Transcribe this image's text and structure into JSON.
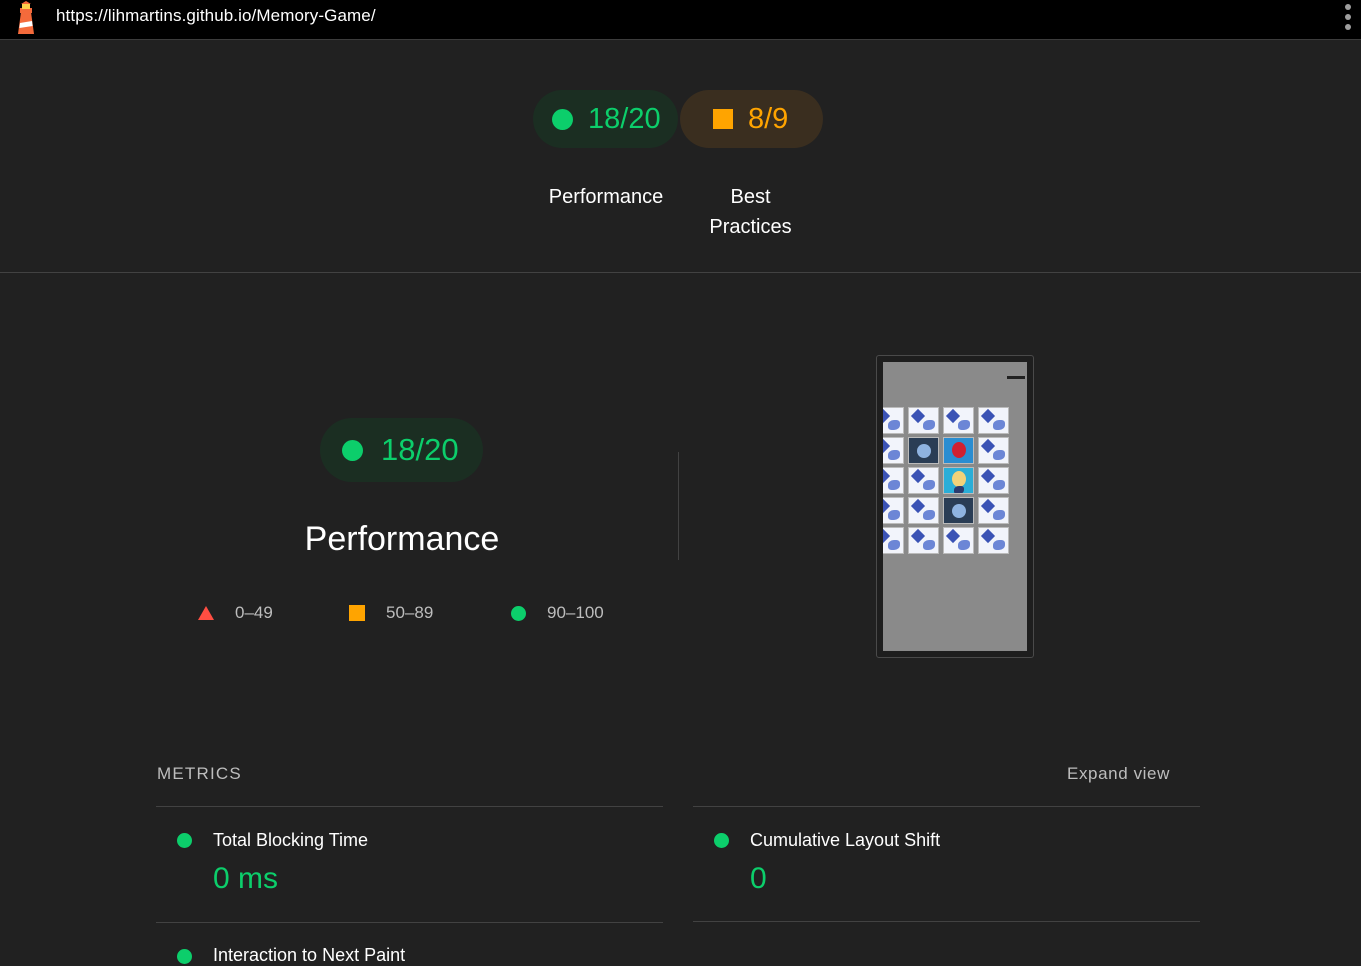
{
  "browser": {
    "url": "https://lihmartins.github.io/Memory-Game/"
  },
  "header_gauges": [
    {
      "score": "18/20",
      "label": "Performance",
      "status": "pass"
    },
    {
      "score": "8/9",
      "label": "Best Practices",
      "status": "average"
    }
  ],
  "main_gauge": {
    "score": "18/20",
    "title": "Performance"
  },
  "legend": [
    {
      "shape": "triangle",
      "range": "0–49",
      "color": "#ff4e42"
    },
    {
      "shape": "square",
      "range": "50–89",
      "color": "#ffa400"
    },
    {
      "shape": "circle",
      "range": "90–100",
      "color": "#0cce6b"
    }
  ],
  "metrics": {
    "header": "METRICS",
    "expand_label": "Expand view",
    "items": [
      {
        "name": "Total Blocking Time",
        "value": "0 ms"
      },
      {
        "name": "Cumulative Layout Shift",
        "value": "0"
      },
      {
        "name": "Interaction to Next Paint",
        "value": ""
      }
    ]
  },
  "colors": {
    "pass": "#0cce6b",
    "average": "#ffa400",
    "fail": "#ff4e42",
    "background": "#212121"
  }
}
